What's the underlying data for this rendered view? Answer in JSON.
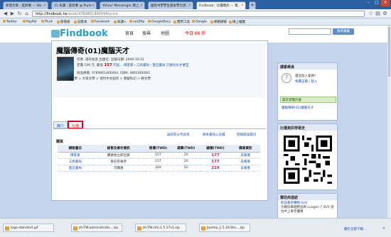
{
  "browser": {
    "tabs": [
      {
        "label": "新增文章 - 提昇專 — Wo..."
      },
      {
        "label": "12 未讀 - 提昇專 @ Plurk..."
      },
      {
        "label": "Yahoo! Messenger 網上..."
      },
      {
        "label": "國民中學學生基本學力測..."
      },
      {
        "label": "Findbook：比價資訊 — 電..."
      }
    ],
    "url_host": "http://findbook.tw",
    "url_path": "/book/9789861466064/price",
    "bookmarks": [
      "Twitter",
      "PayPal",
      "Plurk",
      "部落格",
      "記帳本",
      "Facebook",
      "知識+",
      "net2ftp",
      "GoogleDocs",
      "實用工具",
      "Google",
      "網路硬碟",
      "線上繪圖"
    ]
  },
  "site": {
    "logo": "Findbook",
    "nav": [
      "首頁",
      "搜尋",
      "地圖"
    ],
    "today_label": "今日 66 折",
    "search_button": "搜尋書籍"
  },
  "book": {
    "title": "魔腦傳奇(01)魔腦天才",
    "author_line": "作者: 週丹星遊 出版社:  出版日期: 2009-10-21",
    "price_line_pre": "定價 199 元, 最低",
    "lowest_price": "157",
    "price_line_post": "元起... 博客來・三民書局・蓋亞書局 只要比比才便宜",
    "isbn_line": "商品條碼: 9789861466064, ISBN: 9861466061",
    "category_line": "分類標籤: 文學 > 大眾文學 > 現代中文創作 > 懸疑科幻 > 輕文學"
  },
  "page_tabs": [
    "簡介",
    "比價"
  ],
  "links": [
    "與好友分享此頁",
    "將本書加入比價",
    "回報錯誤資訊"
  ],
  "section_title": "購買",
  "table": {
    "headers": [
      "網路書店",
      "銷售及庫存資訊",
      "售價(TWD)",
      "運費(TWD)",
      "總價(TWD)",
      "購買資訊"
    ],
    "rows": [
      {
        "store": "博客來",
        "stock": "購買後立即出貨",
        "price": "157",
        "ship": "20",
        "total": "177",
        "buy": "去看看"
      },
      {
        "store": "三民書局",
        "stock": "目前有庫存",
        "price": "157",
        "ship": "20",
        "total": "177",
        "buy": "去看看"
      },
      {
        "store": "蓋亞書局",
        "stock": "可購買",
        "price": "169",
        "ship": "50",
        "total": "219",
        "buy": "去看看"
      }
    ]
  },
  "sidebar": {
    "member_title": "讀書專員",
    "login_q": "還沒加入會員?",
    "login_links": "免費註冊 | 登入",
    "recent_title": "最近瀏覽的書",
    "recent_item": "魔腦傳奇(01)魔腦天才",
    "qr_title": "比價資訊帶著走",
    "ad_title": "贊助商連結",
    "ad_link": "新品看新購物:SUV",
    "ad_text": "大觀房車越野品牌 Luxgen 7 SUV 從台中上車享優惠"
  },
  "downloads": [
    {
      "name": "logo-standard.gif"
    },
    {
      "name": "zh-TW.administrato....zip"
    },
    {
      "name": "zh-TW.site.1.5.17v1.zip"
    },
    {
      "name": "Joomla_1.5.18-Sta....zip"
    }
  ],
  "download_all": "顯示全部下載...",
  "colors": {
    "accent": "#1a4fa0",
    "total": "#cc1c6c",
    "selected_tab": "#c8102e"
  }
}
